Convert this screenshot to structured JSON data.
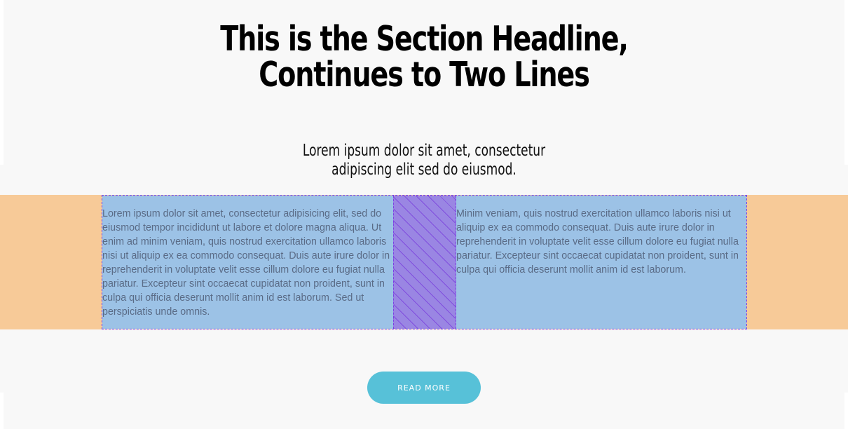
{
  "section": {
    "headline_line1": "This is the Section Headline,",
    "headline_line2": "Continues to Two Lines",
    "subheadline_line1": "Lorem ipsum dolor sit amet, consectetur",
    "subheadline_line2": "adipiscing elit sed do eiusmod."
  },
  "columns": [
    {
      "text": "Lorem ipsum dolor sit amet, consectetur adipisicing elit, sed do eiusmod tempor incididunt ut labore et dolore magna aliqua. Ut enim ad minim veniam, quis nostrud exercitation ullamco laboris nisi ut aliquip ex ea commodo consequat. Duis aute irure dolor in reprehenderit in voluptate velit esse cillum dolore eu fugiat nulla pariatur. Excepteur sint occaecat cupidatat non proident, sunt in culpa qui officia deserunt mollit anim id est laborum. Sed ut perspiciatis unde omnis."
    },
    {
      "text": "Minim veniam, quis nostrud exercitation ullamco laboris nisi ut aliquip ex ea commodo consequat. Duis aute irure dolor in reprehenderit in voluptate velit esse cillum dolore eu fugiat nulla pariatur. Excepteur sint occaecat cupidatat non proident, sunt in culpa qui officia deserunt mollit anim id est laborum."
    }
  ],
  "button": {
    "label": "READ MORE"
  },
  "colors": {
    "section_background": "#f8f8f8",
    "margin_overlay": "#f7ca98",
    "column_overlay": "#9cc2e6",
    "gutter_overlay": "#9a86e3",
    "button_background": "#57c1d8",
    "button_text": "#ffffff"
  }
}
